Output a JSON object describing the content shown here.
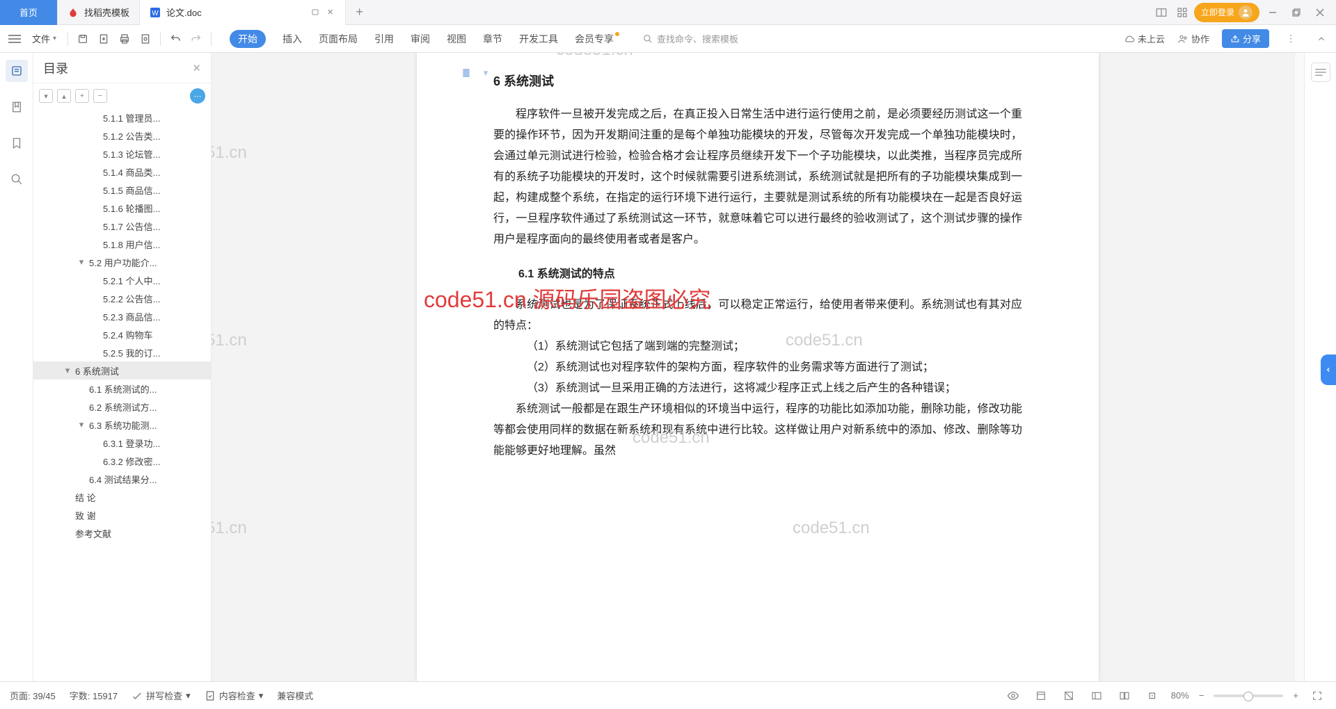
{
  "tabs": {
    "home": "首页",
    "t1": "找稻壳模板",
    "t2": "论文.doc"
  },
  "login_label": "立即登录",
  "ribbon": {
    "file": "文件",
    "tabs": [
      "开始",
      "插入",
      "页面布局",
      "引用",
      "审阅",
      "视图",
      "章节",
      "开发工具",
      "会员专享"
    ],
    "search_placeholder": "查找命令、搜索模板",
    "cloud": "未上云",
    "collab": "协作",
    "share": "分享"
  },
  "outline": {
    "title": "目录",
    "items": [
      {
        "lvl": "l3",
        "txt": "5.1.1  管理员..."
      },
      {
        "lvl": "l3",
        "txt": "5.1.2  公告类..."
      },
      {
        "lvl": "l3",
        "txt": "5.1.3  论坛管..."
      },
      {
        "lvl": "l3",
        "txt": "5.1.4  商品类..."
      },
      {
        "lvl": "l3",
        "txt": "5.1.5  商品信..."
      },
      {
        "lvl": "l3",
        "txt": "5.1.6  轮播图..."
      },
      {
        "lvl": "l3",
        "txt": "5.1.7  公告信..."
      },
      {
        "lvl": "l3",
        "txt": "5.1.8  用户信..."
      },
      {
        "lvl": "l2",
        "txt": "5.2  用户功能介...",
        "caret": "▾"
      },
      {
        "lvl": "l3",
        "txt": "5.2.1  个人中..."
      },
      {
        "lvl": "l3",
        "txt": "5.2.2  公告信..."
      },
      {
        "lvl": "l3",
        "txt": "5.2.3  商品信..."
      },
      {
        "lvl": "l3",
        "txt": "5.2.4  购物车"
      },
      {
        "lvl": "l3",
        "txt": "5.2.5  我的订..."
      },
      {
        "lvl": "l1",
        "txt": "6  系统测试",
        "caret": "▾",
        "sel": true
      },
      {
        "lvl": "l2",
        "txt": "6.1  系统测试的..."
      },
      {
        "lvl": "l2",
        "txt": "6.2  系统测试方..."
      },
      {
        "lvl": "l2",
        "txt": "6.3  系统功能测...",
        "caret": "▾"
      },
      {
        "lvl": "l3",
        "txt": "6.3.1  登录功..."
      },
      {
        "lvl": "l3",
        "txt": "6.3.2  修改密..."
      },
      {
        "lvl": "l2",
        "txt": "6.4  测试结果分..."
      },
      {
        "lvl": "l0",
        "txt": "结    论"
      },
      {
        "lvl": "l0",
        "txt": "致    谢"
      },
      {
        "lvl": "l0",
        "txt": "参考文献"
      }
    ]
  },
  "doc": {
    "h1": "6  系统测试",
    "p1": "程序软件一旦被开发完成之后，在真正投入日常生活中进行运行使用之前，是必须要经历测试这一个重要的操作环节，因为开发期间注重的是每个单独功能模块的开发，尽管每次开发完成一个单独功能模块时，会通过单元测试进行检验，检验合格才会让程序员继续开发下一个子功能模块，以此类推，当程序员完成所有的系统子功能模块的开发时，这个时候就需要引进系统测试，系统测试就是把所有的子功能模块集成到一起，构建成整个系统，在指定的运行环境下进行运行，主要就是测试系统的所有功能模块在一起是否良好运行，一旦程序软件通过了系统测试这一环节，就意味着它可以进行最终的验收测试了，这个测试步骤的操作用户是程序面向的最终使用者或者是客户。",
    "h2": "6.1  系统测试的特点",
    "p2": "系统测试也是为了保证系统正式上线后，可以稳定正常运行，给使用者带来便利。系统测试也有其对应的特点：",
    "li1": "（1）系统测试它包括了端到端的完整测试；",
    "li2": "（2）系统测试也对程序软件的架构方面，程序软件的业务需求等方面进行了测试；",
    "li3": "（3）系统测试一旦采用正确的方法进行，这将减少程序正式上线之后产生的各种错误；",
    "p3": "系统测试一般都是在跟生产环境相似的环境当中运行，程序的功能比如添加功能，删除功能，修改功能等都会使用同样的数据在新系统和现有系统中进行比较。这样做让用户对新系统中的添加、修改、删除等功能能够更好地理解。虽然"
  },
  "watermarks": {
    "wm": "code51.cn",
    "red": "code51.cn  源码乐园盗图必究"
  },
  "status": {
    "page": "页面: 39/45",
    "words": "字数: 15917",
    "spell": "拼写检查",
    "content": "内容检查",
    "compat": "兼容模式",
    "zoom": "80%"
  }
}
